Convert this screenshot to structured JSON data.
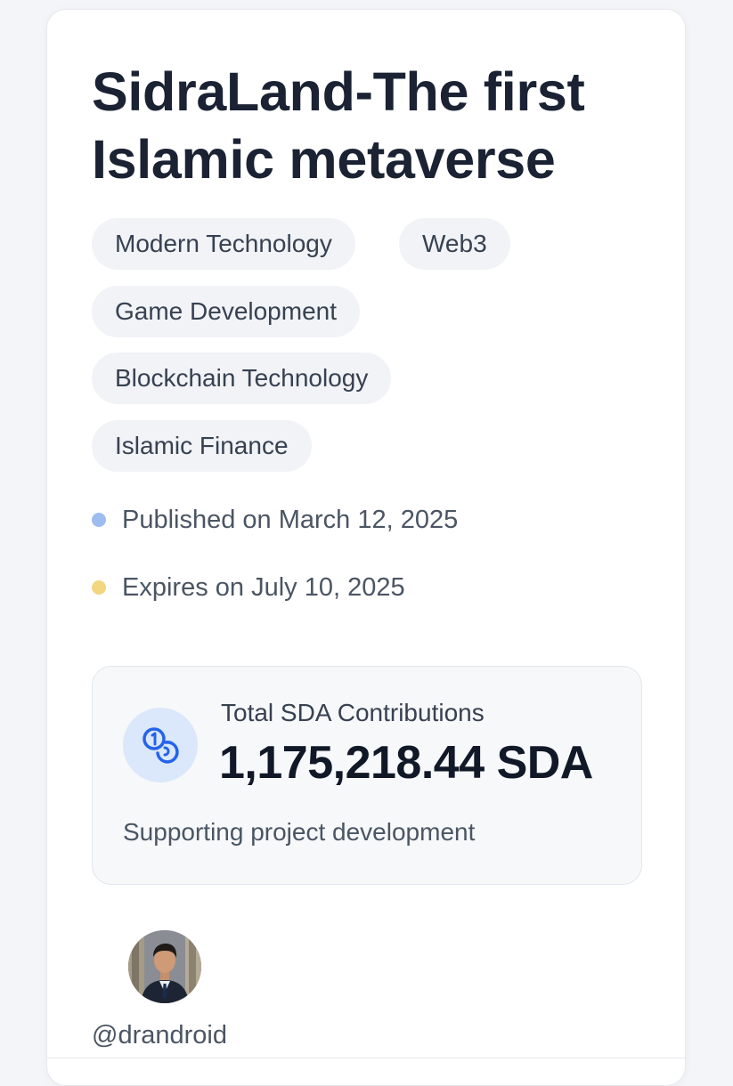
{
  "project": {
    "title": "SidraLand-The first Islamic metaverse",
    "tags": [
      "Modern Technology",
      "Web3",
      "Game Development",
      "Blockchain Technology",
      "Islamic Finance"
    ],
    "published": "Published on March 12, 2025",
    "expires": "Expires on July 10, 2025"
  },
  "contributions": {
    "label": "Total SDA Contributions",
    "value": "1,175,218.44 SDA",
    "subtitle": "Supporting project development",
    "icon": "coins-icon"
  },
  "author": {
    "handle": "@drandroid"
  },
  "colors": {
    "published_dot": "#9dbcf0",
    "expires_dot": "#f2d680",
    "icon_accent": "#2563eb"
  }
}
